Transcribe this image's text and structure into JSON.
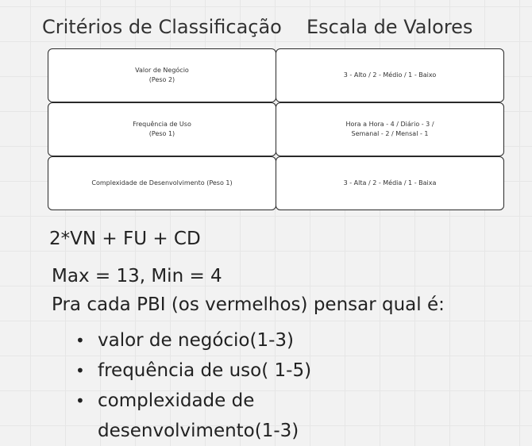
{
  "headers": {
    "criteria": "Critérios de Classificação",
    "scale": "Escala de Valores"
  },
  "rows": [
    {
      "criterion": "Valor de Negócio\n(Peso 2)",
      "scale": "3 - Alto / 2 - Médio / 1 - Baixo"
    },
    {
      "criterion": "Frequência de Uso\n(Peso 1)",
      "scale": "Hora a Hora - 4 / Diário - 3 /\nSemanal - 2 / Mensal - 1"
    },
    {
      "criterion": "Complexidade de Desenvolvimento (Peso 1)",
      "scale": "3 - Alta / 2 - Média / 1 - Baixa"
    }
  ],
  "formula": "2*VN + FU + CD",
  "range": "Max = 13, Min = 4",
  "instruction": "Pra cada PBI (os vermelhos) pensar qual é:",
  "bullets": [
    "valor de negócio(1-3)",
    "frequência de uso( 1-5)",
    "complexidade de desenvolvimento(1-3)"
  ]
}
